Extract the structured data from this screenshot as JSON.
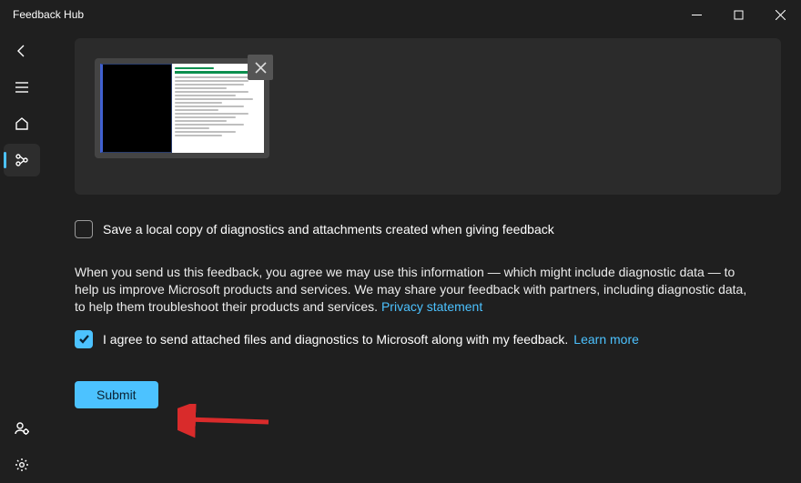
{
  "window": {
    "title": "Feedback Hub"
  },
  "checkboxes": {
    "saveLocal": {
      "label": "Save a local copy of diagnostics and attachments created when giving feedback",
      "checked": false
    },
    "consent": {
      "label": "I agree to send attached files and diagnostics to Microsoft along with my feedback.",
      "checked": true,
      "learnMore": "Learn more"
    }
  },
  "disclosure": {
    "text": "When you send us this feedback, you agree we may use this information — which might include diagnostic data — to help us improve Microsoft products and services. We may share your feedback with partners, including diagnostic data, to help them troubleshoot their products and services.",
    "privacyLink": "Privacy statement"
  },
  "buttons": {
    "submit": "Submit"
  },
  "nav": {
    "back": "back",
    "menu": "menu",
    "home": "home",
    "feedback": "feedback",
    "account": "account",
    "settings": "settings"
  }
}
